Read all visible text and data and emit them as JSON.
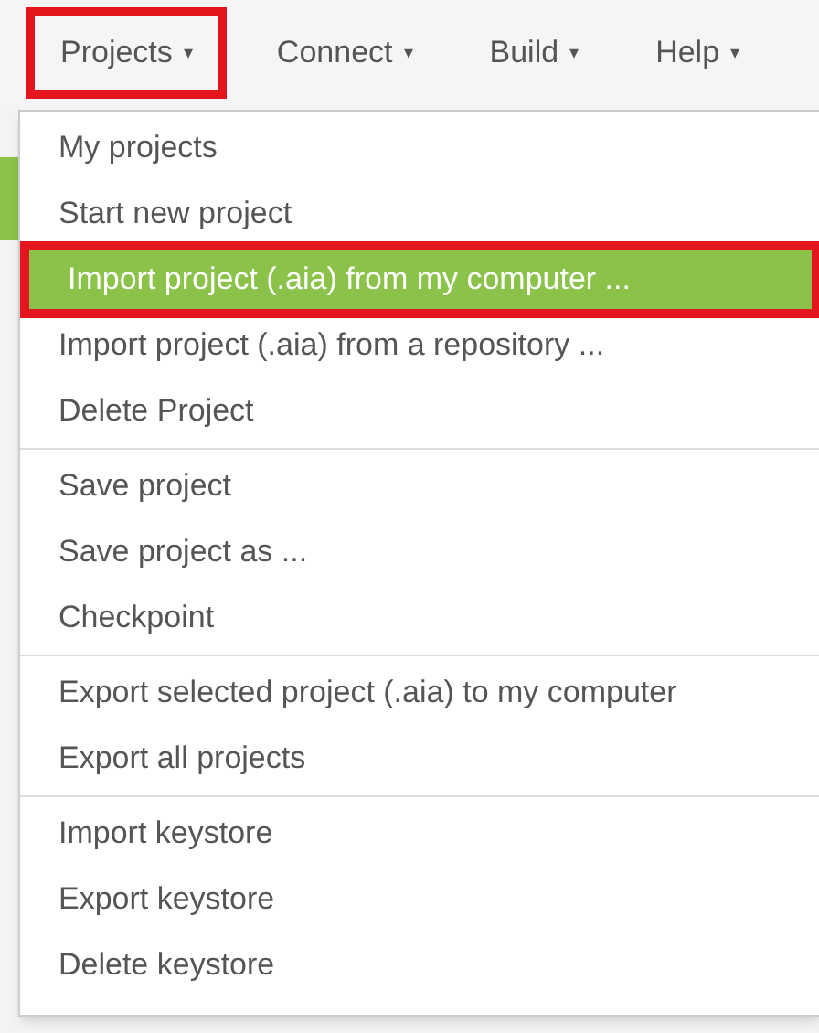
{
  "menubar": [
    {
      "label": "Projects",
      "caret": "▾",
      "highlighted": true
    },
    {
      "label": "Connect",
      "caret": "▾",
      "highlighted": false
    },
    {
      "label": "Build",
      "caret": "▾",
      "highlighted": false
    },
    {
      "label": "Help",
      "caret": "▾",
      "highlighted": false
    }
  ],
  "menu": {
    "groups": [
      [
        {
          "label": "My projects",
          "selected": false,
          "highlighted": false
        },
        {
          "label": "Start new project",
          "selected": false,
          "highlighted": false
        },
        {
          "label": "Import project (.aia) from my computer ...",
          "selected": true,
          "highlighted": true
        },
        {
          "label": "Import project (.aia) from a repository ...",
          "selected": false,
          "highlighted": false
        },
        {
          "label": "Delete Project",
          "selected": false,
          "highlighted": false
        }
      ],
      [
        {
          "label": "Save project",
          "selected": false,
          "highlighted": false
        },
        {
          "label": "Save project as ...",
          "selected": false,
          "highlighted": false
        },
        {
          "label": "Checkpoint",
          "selected": false,
          "highlighted": false
        }
      ],
      [
        {
          "label": "Export selected project (.aia) to my computer",
          "selected": false,
          "highlighted": false
        },
        {
          "label": "Export all projects",
          "selected": false,
          "highlighted": false
        }
      ],
      [
        {
          "label": "Import keystore",
          "selected": false,
          "highlighted": false
        },
        {
          "label": "Export keystore",
          "selected": false,
          "highlighted": false
        },
        {
          "label": "Delete keystore",
          "selected": false,
          "highlighted": false
        }
      ]
    ]
  }
}
